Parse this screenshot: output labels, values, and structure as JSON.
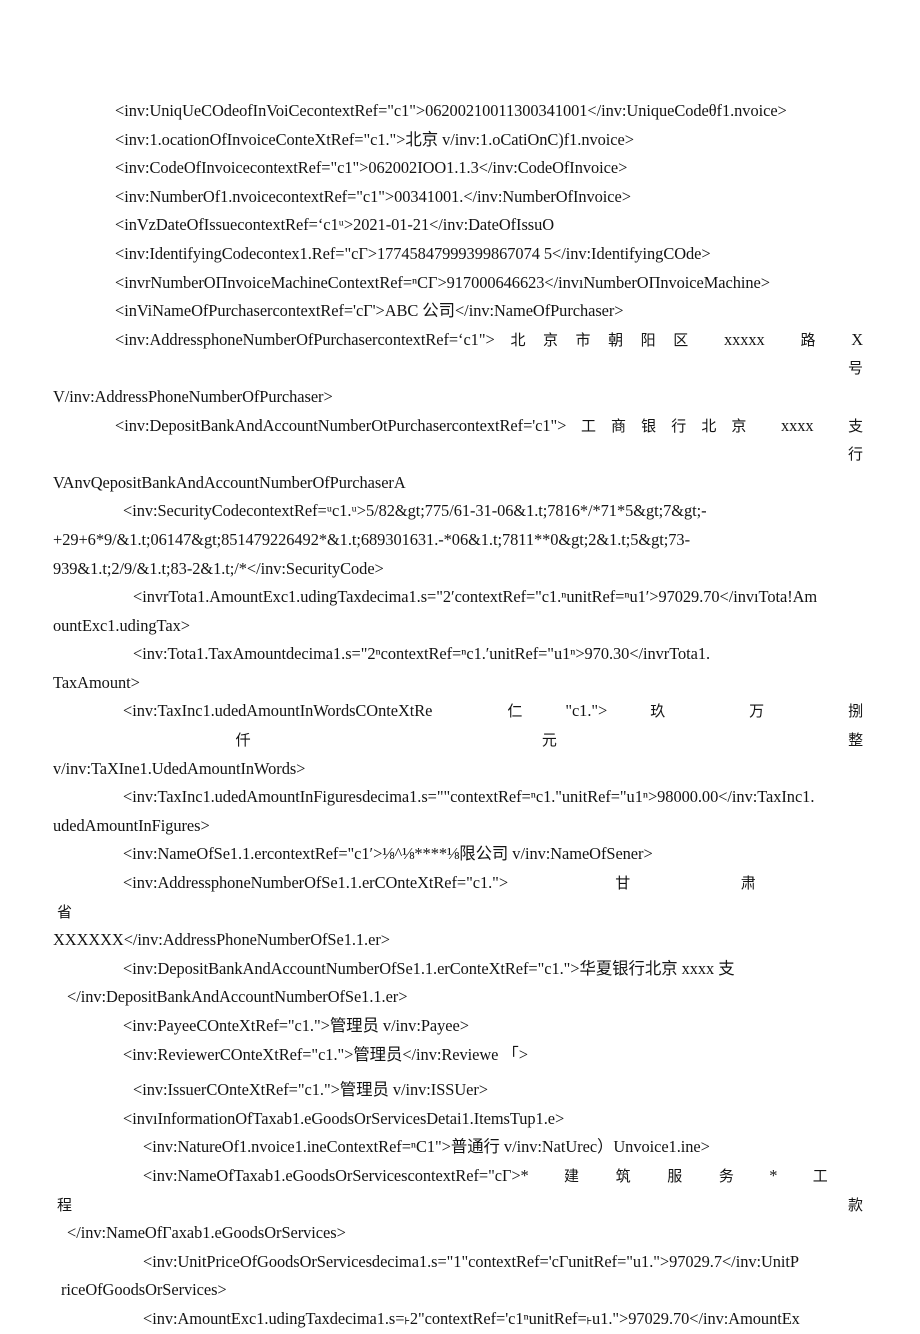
{
  "document": {
    "kind": "scanned-xml-invoice-page",
    "page_background": "#ffffff",
    "text_color": "#131313",
    "lines": [
      {
        "id": "unique-code-of-invoice",
        "indent": "ind-1",
        "text": "<inv:UniqUeCOdeofInVoiCecontextRef=\"c1\">06200210011300341001</inv:UniqueCodeθf1.nvoice>"
      },
      {
        "id": "location-of-invoice",
        "indent": "ind-1",
        "text": "<inv:1.ocationOfInvoiceConteXtRef=\"c1.\">北京 v/inv:1.oCatiOnC)f1.nvoice>"
      },
      {
        "id": "code-of-invoice",
        "indent": "ind-1",
        "text": "<inv:CodeOfInvoicecontextRef=\"c1\">062002IOO1.1.3</inv:CodeOfInvoice>"
      },
      {
        "id": "number-of-invoice",
        "indent": "ind-1",
        "text": "<inv:NumberOf1.nvoicecontextRef=\"c1\">00341001.</inv:NumberOfInvoice>"
      },
      {
        "id": "date-of-issue",
        "indent": "ind-1",
        "text": "<inVzDateOfIssuecontextRef=ʻc1ᵘ>2021-01-21</inv:DateOfIssuO"
      },
      {
        "id": "identifying-code",
        "indent": "ind-1",
        "text": "<inv:IdentifyingCodecontex1.Ref=\"cΓ>17745847999399867074 5</inv:IdentifyingCOde>"
      },
      {
        "id": "number-of-invoice-machine",
        "indent": "ind-1",
        "text": "<invrNumberOΠnvoiceMachineContextRef=ⁿCΓ>917000646623</invıNumberOΠnvoiceMachine>"
      },
      {
        "id": "name-of-purchaser",
        "indent": "ind-1",
        "text": "<inViNameOfPurchasercontextRef='cΓ'>ABC 公司</inv:NameOfPurchaser>"
      }
    ],
    "purchaser_address": {
      "id": "address-phone-number-of-purchaser",
      "prefix": "<inv:AddressphoneNumberOfPurchasercontextRef=ʻc1\">",
      "value_tokens": [
        "北",
        "京",
        "市",
        "朝",
        "阳",
        "区",
        "xxxxx",
        "路",
        "X",
        "号"
      ],
      "continuation": "V/inv:AddressPhoneNumberOfPurchaser>"
    },
    "purchaser_bank": {
      "id": "deposit-bank-and-account-number-of-purchaser",
      "prefix": "<inv:DepositBankAndAccountNumberOtPurchasercontextRef='c1\">",
      "value_tokens": [
        "工",
        "商",
        "银",
        "行",
        "北",
        "京",
        "xxxx",
        "支",
        "行"
      ],
      "continuation": "VAnvQepositBankAndAccountNumberOfPurchaserA"
    },
    "security_code": {
      "id": "security-code",
      "line1": "<inv:SecurityCodecontextRef=ᵘc1.ᵘ>5/82&gt;775/61-31-06&1.t;7816*/*71*5&gt;7&gt;-",
      "line2": "+29+6*9/&1.t;06147&gt;851479226492*&1.t;689301631.-*06&1.t;7811**0&gt;2&1.t;5&gt;73-",
      "line3": "939&1.t;2/9/&1.t;83-2&1.t;/*</inv:SecurityCode>"
    },
    "totals": [
      {
        "id": "total-amount-excluding-tax",
        "indent": "ind-2",
        "text": "<invrTota1.AmountExc1.udingTaxdecima1.s=\"2ʹcontextRef=\"c1.ⁿunitRef=ⁿu1ʹ>97029.70</invıTota!Am",
        "continuation": "ountExc1.udingTax>"
      },
      {
        "id": "total-tax-amount",
        "indent": "ind-2",
        "text": "<inv:Tota1.TaxAmountdecima1.s=\"2ⁿcontextRef=ⁿc1.ʹunitRef=\"u1ⁿ>970.30</invrTota1.",
        "continuation": "TaxAmount>"
      }
    ],
    "amount_in_words": {
      "id": "tax-included-amount-in-words",
      "prefix": "<inv:TaxInc1.udedAmountInWordsCOnteXtRe",
      "mid": "仁",
      "quote": "\"c1.\">",
      "value_tokens": [
        "玖",
        "万",
        "捌",
        "仟",
        "元",
        "整"
      ],
      "continuation": "v/inv:TaXIne1.UdedAmountInWords>"
    },
    "amount_in_figures": {
      "id": "tax-included-amount-in-figures",
      "text": "<inv:TaxInc1.udedAmountInFiguresdecima1.s=\"\"contextRef=ⁿc1.\"unitRef=\"u1ⁿ>98000.00</inv:TaxInc1.",
      "continuation": "udedAmountInFigures>"
    },
    "seller": {
      "name": {
        "id": "name-of-seller",
        "text": "<inv:NameOfSe1.1.ercontextRef=\"c1ʹ>⅛^⅛****⅛限公司 v/inv:NameOfSener>"
      },
      "address": {
        "id": "address-phone-number-of-seller",
        "prefix": "<inv:AddressphoneNumberOfSe1.1.erCOnteXtRef=\"c1.\">",
        "value_tokens": [
          "甘",
          "肃",
          "省"
        ],
        "continuation": "XXXXXX</inv:AddressPhoneNumberOfSe1.1.er>"
      },
      "bank": {
        "id": "deposit-bank-and-account-number-of-seller",
        "text": "<inv:DepositBankAndAccountNumberOfSe1.1.erConteXtRef=\"c1.\">华夏银行北京 xxxx 支",
        "continuation": "</inv:DepositBankAndAccountNumberOfSe1.1.er>"
      }
    },
    "signatories": [
      {
        "id": "payee",
        "indent": "ind-2",
        "text": "<inv:PayeeCOnteXtRef=\"c1.\">管理员 v/inv:Payee>"
      },
      {
        "id": "reviewer",
        "indent": "ind-2",
        "text": "<inv:ReviewerCOnteXtRef=\"c1.\">管理员</inv:Reviewe 「>"
      },
      {
        "id": "issuer",
        "indent": "ind-3",
        "text": "<inv:IssuerCOnteXtRef=\"c1.\">管理员 v/inv:ISSUer>"
      }
    ],
    "detail": {
      "items_tuple": {
        "id": "information-of-taxable-goods-or-services-detail",
        "indent": "ind-2",
        "text": "<invıInformationOfTaxab1.eGoodsOrServicesDetai1.ItemsTup1.e>"
      },
      "nature_of_invoice_line": {
        "id": "nature-of-invoice-line",
        "indent": "ind-3",
        "text": "<inv:NatureOf1.nvoice1.ineContextRef=ⁿC1\">普通行 v/inv:NatUrec）Unvoice1.ine>"
      },
      "name_of_goods": {
        "id": "name-of-taxable-goods-or-services",
        "prefix": "<inv:NameOfTaxab1.eGoodsOrServicescontextRef=\"cΓ>*",
        "value_tokens": [
          "建",
          "筑",
          "服",
          "务",
          "*",
          "工",
          "程",
          "款"
        ],
        "continuation": "</inv:NameOfΓaxab1.eGoodsOrServices>"
      },
      "unit_price": {
        "id": "unit-price-of-goods-or-services",
        "indent": "ind-4",
        "text": "<inv:UnitPriceOfGoodsOrServicesdecima1.s=\"1\"contextRef='cΓunitRef=\"u1.\">97029.7</inv:UnitP",
        "continuation": "riceOfGoodsOrServices>"
      },
      "amount_excluding_tax": {
        "id": "amount-excluding-tax",
        "indent": "ind-4",
        "text": "<inv:AmountExc1.udingTaxdecima1.s=˫2\"contextRef='c1ⁿunitRef=˫u1.\">97029.70</inv:AmountEx"
      }
    }
  }
}
